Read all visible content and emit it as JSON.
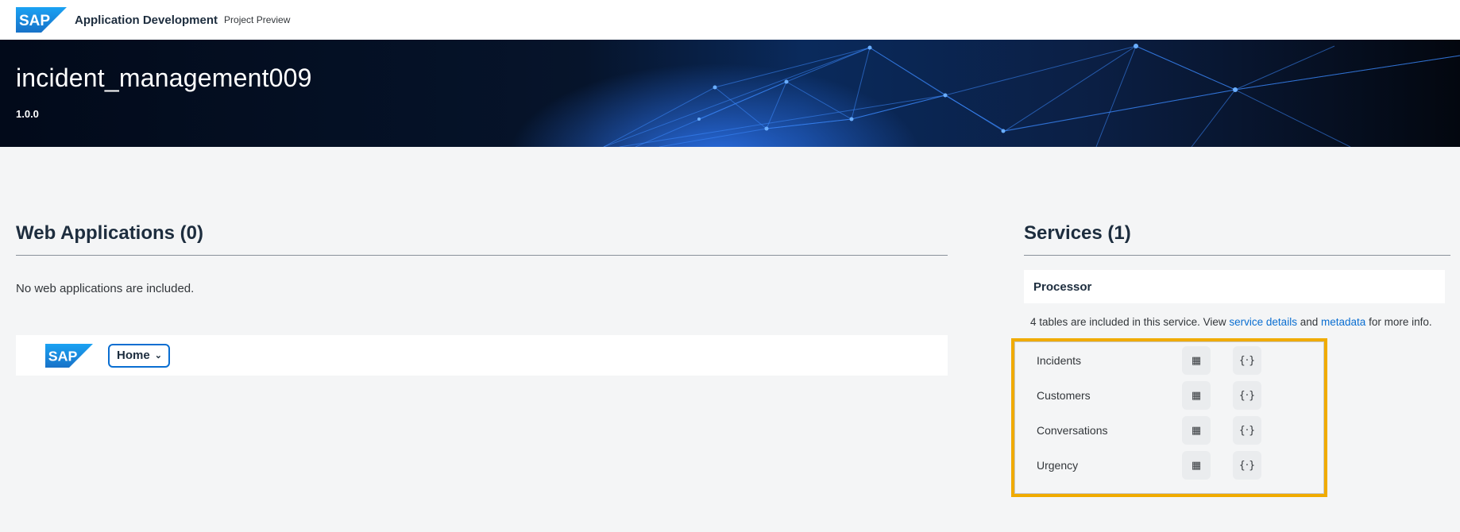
{
  "shell": {
    "logo_text": "SAP",
    "app_title": "Application Development",
    "app_subtitle": "Project Preview"
  },
  "hero": {
    "project_name": "incident_management009",
    "version": "1.0.0"
  },
  "web_applications": {
    "title": "Web Applications (0)",
    "empty_message": "No web applications are included.",
    "launchpad": {
      "logo_text": "SAP",
      "home_label": "Home"
    }
  },
  "services": {
    "title": "Services (1)",
    "service_name": "Processor",
    "info_prefix": "4 tables are included in this service. View",
    "details_link": "service details",
    "and_text": "and",
    "metadata_link": "metadata",
    "info_suffix": "for more info.",
    "tables": [
      {
        "name": "Incidents",
        "table_icon": "grid-icon",
        "api_icon": "code-braces-icon"
      },
      {
        "name": "Customers",
        "table_icon": "grid-icon",
        "api_icon": "code-braces-icon"
      },
      {
        "name": "Conversations",
        "table_icon": "grid-icon",
        "api_icon": "code-braces-icon"
      },
      {
        "name": "Urgency",
        "table_icon": "grid-icon",
        "api_icon": "code-braces-icon"
      }
    ],
    "highlight_color": "#f0ab00",
    "link_color": "#0a6ed1"
  }
}
